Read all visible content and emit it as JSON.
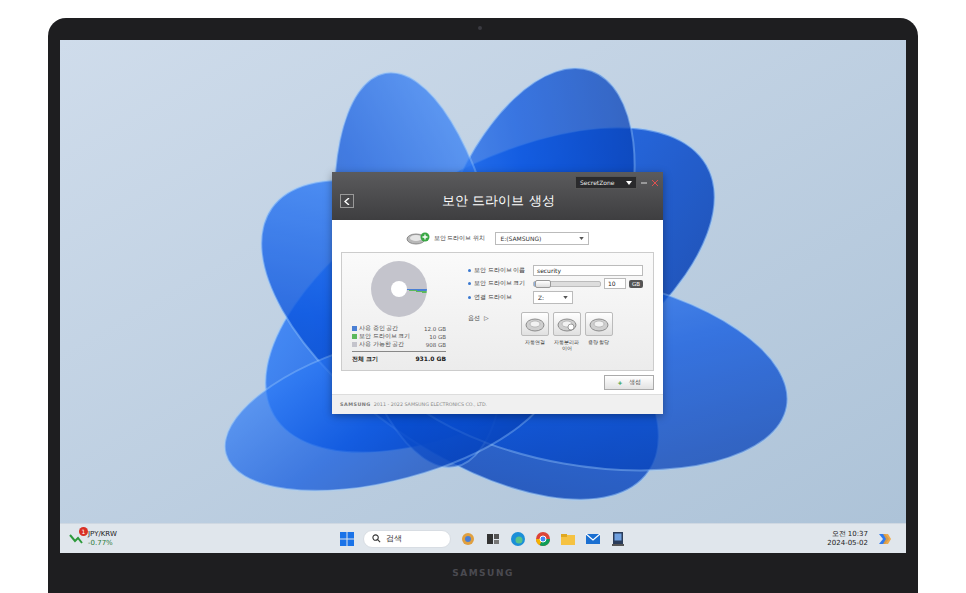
{
  "window": {
    "title": "보안 드라이브 생성",
    "app_select": "SecretZone"
  },
  "location": {
    "label": "보안 드라이브 위치",
    "value": "E:(SAMSUNG)"
  },
  "usage": {
    "legend": [
      {
        "label": "사용 중인 공간",
        "value": "12.0 GB",
        "amount": 12.0,
        "color": "#4a7fd4"
      },
      {
        "label": "보안 드라이브 크기",
        "value": "10 GB",
        "amount": 10,
        "color": "#5cb85c"
      },
      {
        "label": "사용 가능한 공간",
        "value": "908 GB",
        "amount": 908,
        "color": "#c4c4cc"
      }
    ],
    "total_label": "전체 크기",
    "total_value": "931.0 GB"
  },
  "form": {
    "fields": [
      {
        "kind": "text",
        "label": "보안 드라이브 이름",
        "value": "security"
      },
      {
        "kind": "slider",
        "label": "보안 드라이브 크기",
        "level": 0.05,
        "value": "10",
        "unit": "GB"
      },
      {
        "kind": "select",
        "label": "연결 드라이브",
        "value": "Z:"
      }
    ]
  },
  "options": {
    "label": "옵션",
    "arrow": "▷",
    "items": [
      {
        "label": "자동연결"
      },
      {
        "label": "자동분리파이어"
      },
      {
        "label": "용량 할당"
      }
    ]
  },
  "create_button": {
    "icon": "+",
    "label": "생성"
  },
  "footer": {
    "brand": "SAMSUNG",
    "copyright": "2011 - 2022 SAMSUNG ELECTRONICS CO., LTD."
  },
  "taskbar": {
    "widget": {
      "title": "JPY/KRW",
      "change": "-0.77%",
      "badge": "1"
    },
    "search": {
      "placeholder": "검색"
    },
    "clock": {
      "time": "오전 10:37",
      "date": "2024-05-02"
    }
  },
  "device": {
    "brand": "SAMSUNG"
  }
}
